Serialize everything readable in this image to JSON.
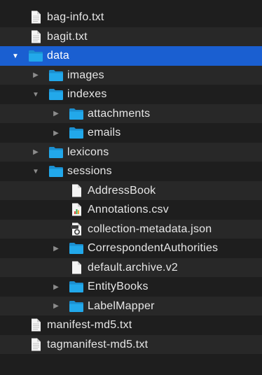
{
  "tree": {
    "rows": [
      {
        "label": "bag-info.txt",
        "depth": 0,
        "kind": "file",
        "icon": "text-file-icon",
        "disclosure": "none"
      },
      {
        "label": "bagit.txt",
        "depth": 0,
        "kind": "file",
        "icon": "text-file-icon",
        "disclosure": "none"
      },
      {
        "label": "data",
        "depth": 0,
        "kind": "folder",
        "icon": "folder-icon",
        "disclosure": "expanded",
        "selected": true
      },
      {
        "label": "images",
        "depth": 1,
        "kind": "folder",
        "icon": "folder-icon",
        "disclosure": "collapsed"
      },
      {
        "label": "indexes",
        "depth": 1,
        "kind": "folder",
        "icon": "folder-icon",
        "disclosure": "expanded"
      },
      {
        "label": "attachments",
        "depth": 2,
        "kind": "folder",
        "icon": "folder-icon",
        "disclosure": "collapsed"
      },
      {
        "label": "emails",
        "depth": 2,
        "kind": "folder",
        "icon": "folder-icon",
        "disclosure": "collapsed"
      },
      {
        "label": "lexicons",
        "depth": 1,
        "kind": "folder",
        "icon": "folder-icon",
        "disclosure": "collapsed"
      },
      {
        "label": "sessions",
        "depth": 1,
        "kind": "folder",
        "icon": "folder-icon",
        "disclosure": "expanded"
      },
      {
        "label": "AddressBook",
        "depth": 2,
        "kind": "file",
        "icon": "document-icon",
        "disclosure": "none"
      },
      {
        "label": "Annotations.csv",
        "depth": 2,
        "kind": "file",
        "icon": "csv-file-icon",
        "disclosure": "none"
      },
      {
        "label": "collection-metadata.json",
        "depth": 2,
        "kind": "file",
        "icon": "json-file-icon",
        "disclosure": "none"
      },
      {
        "label": "CorrespondentAuthorities",
        "depth": 2,
        "kind": "folder",
        "icon": "folder-icon",
        "disclosure": "collapsed"
      },
      {
        "label": "default.archive.v2",
        "depth": 2,
        "kind": "file",
        "icon": "document-icon",
        "disclosure": "none"
      },
      {
        "label": "EntityBooks",
        "depth": 2,
        "kind": "folder",
        "icon": "folder-icon",
        "disclosure": "collapsed"
      },
      {
        "label": "LabelMapper",
        "depth": 2,
        "kind": "folder",
        "icon": "folder-icon",
        "disclosure": "collapsed"
      },
      {
        "label": "manifest-md5.txt",
        "depth": 0,
        "kind": "file",
        "icon": "text-file-icon",
        "disclosure": "none"
      },
      {
        "label": "tagmanifest-md5.txt",
        "depth": 0,
        "kind": "file",
        "icon": "text-file-icon",
        "disclosure": "none"
      }
    ]
  },
  "colors": {
    "background": "#1e1e1e",
    "alt_row": "#282828",
    "selection": "#1a5fd1",
    "folder": "#1fa3e6",
    "text": "#e6e6e6"
  },
  "glyphs": {
    "expanded": "▼",
    "collapsed": "▶"
  }
}
